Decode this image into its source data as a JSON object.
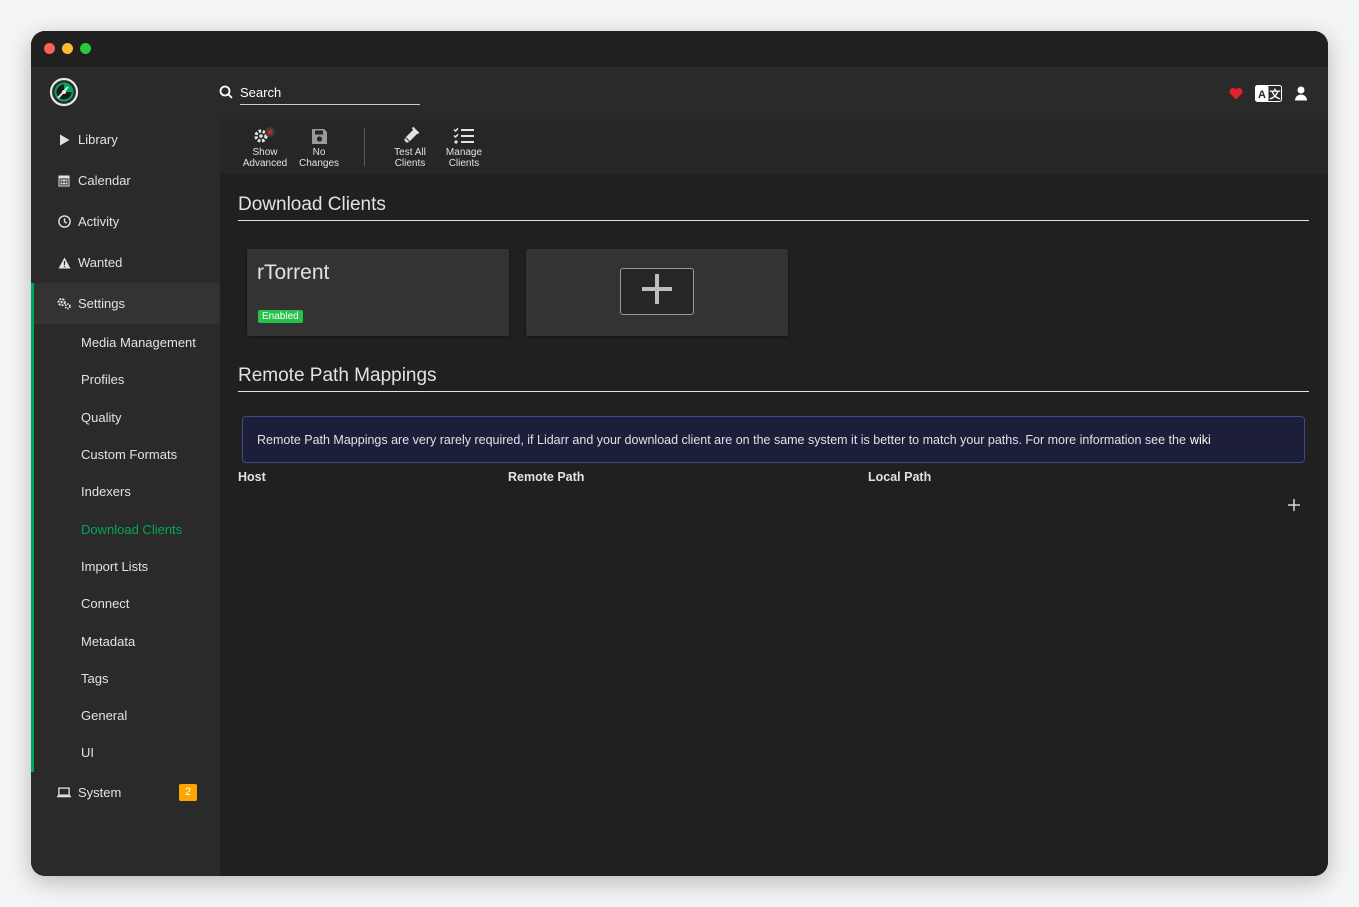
{
  "search": {
    "placeholder": "Search"
  },
  "sidebar": {
    "items": [
      {
        "label": "Library",
        "icon": "play-icon"
      },
      {
        "label": "Calendar",
        "icon": "calendar-icon"
      },
      {
        "label": "Activity",
        "icon": "clock-icon"
      },
      {
        "label": "Wanted",
        "icon": "warning-icon"
      }
    ],
    "settings": {
      "label": "Settings",
      "icon": "cogs-icon",
      "children": [
        "Media Management",
        "Profiles",
        "Quality",
        "Custom Formats",
        "Indexers",
        "Download Clients",
        "Import Lists",
        "Connect",
        "Metadata",
        "Tags",
        "General",
        "UI"
      ],
      "active_child": "Download Clients"
    },
    "system": {
      "label": "System",
      "icon": "laptop-icon",
      "badge": "2"
    }
  },
  "toolbar": {
    "show_advanced": [
      "Show",
      "Advanced"
    ],
    "no_changes": [
      "No",
      "Changes"
    ],
    "test_all": [
      "Test All",
      "Clients"
    ],
    "manage": [
      "Manage",
      "Clients"
    ]
  },
  "download_clients": {
    "title": "Download Clients",
    "clients": [
      {
        "name": "rTorrent",
        "status": "Enabled"
      }
    ]
  },
  "remote_path_mappings": {
    "title": "Remote Path Mappings",
    "info": "Remote Path Mappings are very rarely required, if Lidarr and your download client are on the same system it is better to match your paths. For more information see the",
    "wiki": "wiki",
    "columns": [
      "Host",
      "Remote Path",
      "Local Path"
    ]
  },
  "colors": {
    "accent": "#00a65b",
    "enabled": "#27c24c",
    "badge": "#ffa500",
    "heart": "#e4222e"
  }
}
